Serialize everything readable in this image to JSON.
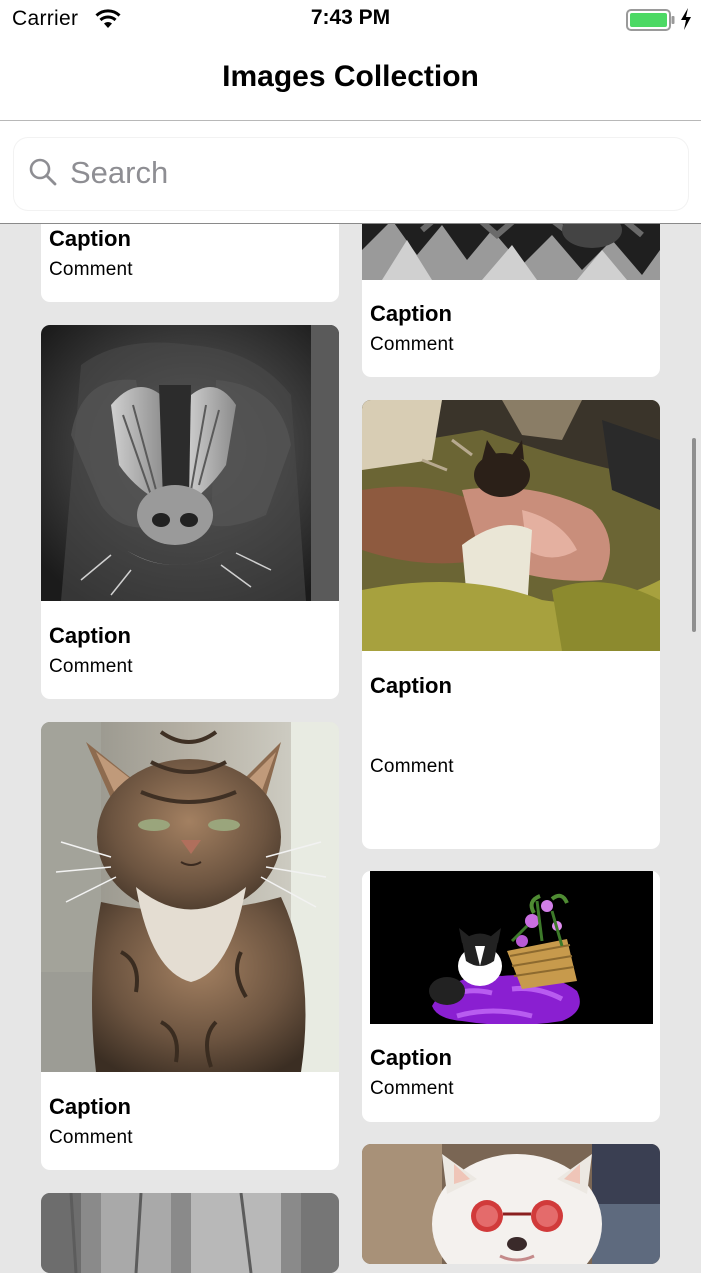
{
  "status_bar": {
    "carrier": "Carrier",
    "time": "7:43 PM"
  },
  "nav": {
    "title": "Images Collection"
  },
  "search": {
    "placeholder": "Search"
  },
  "cards": [
    {
      "caption": "Caption",
      "comment": "Comment",
      "image": "partial card"
    },
    {
      "caption": "Caption",
      "comment": "Comment",
      "image": "black and white bird"
    },
    {
      "caption": "Caption",
      "comment": "Comment",
      "image": "mandrill face"
    },
    {
      "caption": "Caption",
      "comment": "Comment",
      "image": "cat on cushions"
    },
    {
      "caption": "Caption",
      "comment": "Comment",
      "image": "tabby cat"
    },
    {
      "caption": "Caption",
      "comment": "Comment",
      "image": "cat with purple flowers"
    },
    {
      "caption": "",
      "comment": "",
      "image": "grey partial image"
    },
    {
      "caption": "",
      "comment": "",
      "image": "white dog with sunglasses"
    }
  ]
}
